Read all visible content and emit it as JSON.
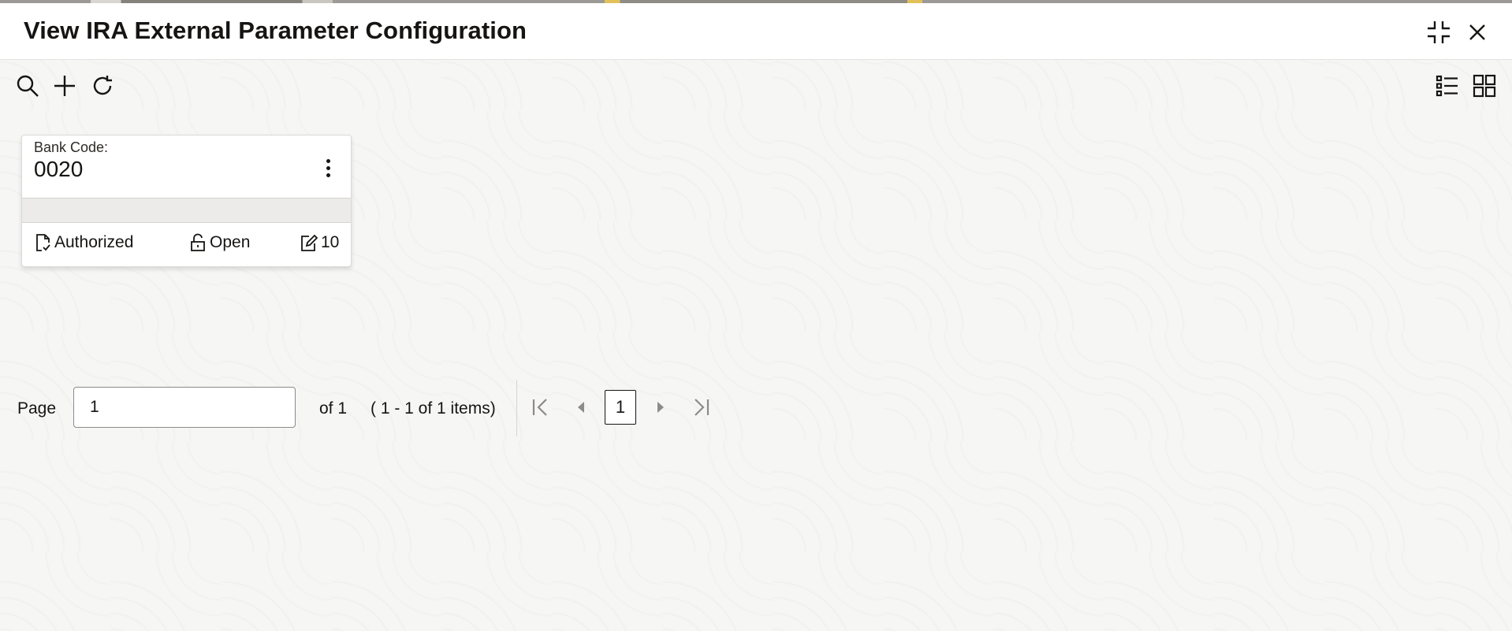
{
  "header": {
    "title": "View IRA External Parameter Configuration",
    "icons": [
      "minimize-icon",
      "close-icon"
    ]
  },
  "toolbar": {
    "icons": [
      "search-icon",
      "add-icon",
      "refresh-icon",
      "list-view-icon",
      "grid-view-icon"
    ]
  },
  "card": {
    "label": "Bank Code:",
    "value": "0020",
    "status": "Authorized",
    "lock_status": "Open",
    "modification_count": "10"
  },
  "pagination": {
    "page_label": "Page",
    "page_value": "1",
    "of_text": "of 1",
    "items_text": "( 1 - 1 of 1 items)",
    "current_page": "1"
  },
  "colors": {
    "text": "#161513",
    "header_bg": "#ffffff",
    "page_bg": "#f6f6f5",
    "disabled_icon": "#8e8b86"
  }
}
